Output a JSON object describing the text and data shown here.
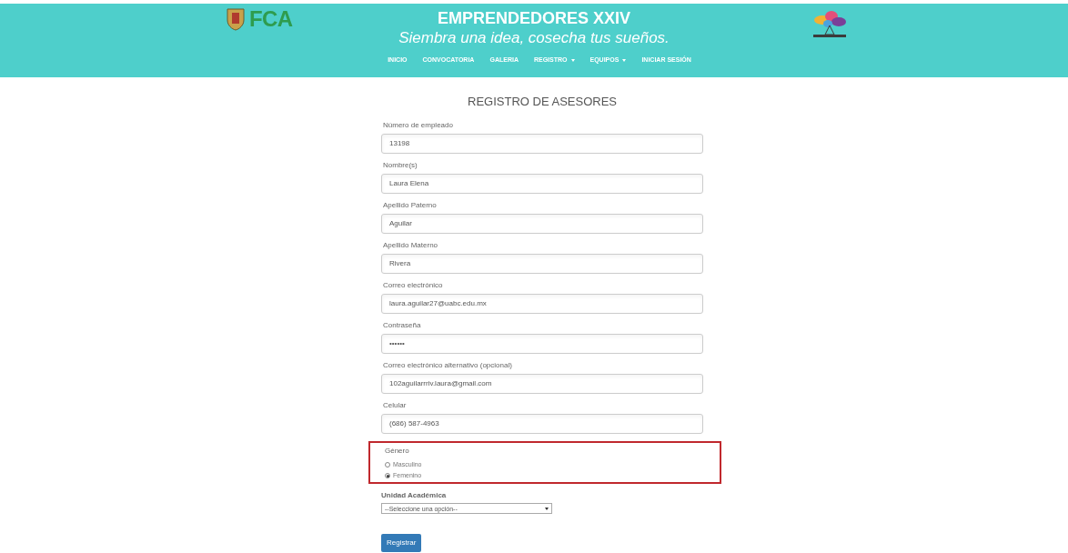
{
  "header": {
    "logo_text": "FCA",
    "title": "EMPRENDEDORES XXIV",
    "subtitle": "Siembra una idea, cosecha tus sueños.",
    "nav": [
      {
        "label": "INICIO",
        "dropdown": false
      },
      {
        "label": "CONVOCATORIA",
        "dropdown": false
      },
      {
        "label": "GALERIA",
        "dropdown": false
      },
      {
        "label": "REGISTRO",
        "dropdown": true
      },
      {
        "label": "EQUIPOS",
        "dropdown": true
      },
      {
        "label": "INICIAR SESIÓN",
        "dropdown": false
      }
    ]
  },
  "form": {
    "title": "REGISTRO DE ASESORES",
    "fields": [
      {
        "label": "Número de empleado",
        "value": "13198"
      },
      {
        "label": "Nombre(s)",
        "value": "Laura Elena"
      },
      {
        "label": "Apellido Paterno",
        "value": "Aguilar"
      },
      {
        "label": "Apellido Materno",
        "value": "Rivera"
      },
      {
        "label": "Correo electrónico",
        "value": "laura.aguilar27@uabc.edu.mx"
      },
      {
        "label": "Contraseña",
        "value": "••••••"
      },
      {
        "label": "Correo electrónico alternativo (opcional)",
        "value": "102aguilarrriv.laura@gmail.com"
      },
      {
        "label": "Celular",
        "value": "(686) 587-4963"
      }
    ],
    "gender": {
      "label": "Género",
      "highlighted": true,
      "options": [
        {
          "label": "Masculino",
          "selected": false
        },
        {
          "label": "Femenino",
          "selected": true
        }
      ]
    },
    "unit": {
      "label": "Unidad Académica",
      "value": "--Seleccione una opción--"
    },
    "submit": "Registrar"
  }
}
